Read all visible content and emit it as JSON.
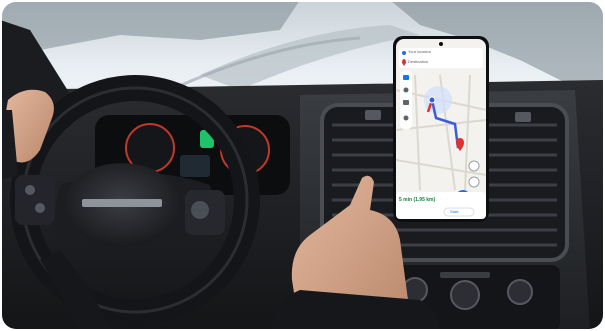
{
  "phone": {
    "search_placeholder": "Your location",
    "destination": "Destination",
    "eta": "5 min (1.95 km)",
    "start_label": "Start"
  },
  "colors": {
    "route": "#3b5bdb",
    "route_alt": "#e03131",
    "fab": "#1a73e8",
    "eta": "#188038"
  },
  "icons": [
    "car-icon",
    "walk-icon",
    "transit-icon",
    "bike-icon",
    "compass-icon",
    "location-pin-icon",
    "navigate-icon",
    "mic-icon"
  ]
}
